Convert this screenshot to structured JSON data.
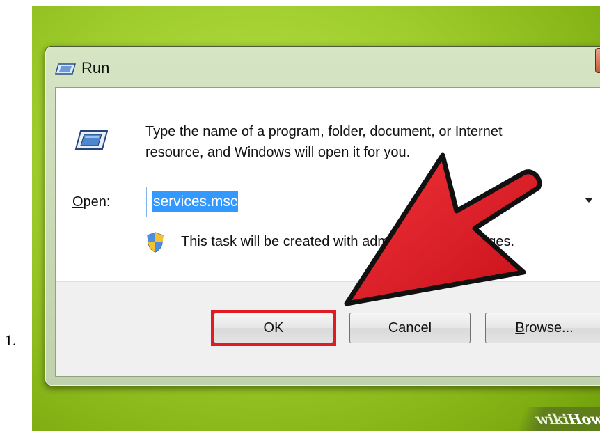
{
  "list_number": "1.",
  "dialog": {
    "title": "Run",
    "description_line1": "Type the name of a program, folder, document, or Internet",
    "description_line2": "resource, and Windows will open it for you.",
    "open_label_u": "O",
    "open_label_rest": "pen:",
    "open_value": "services.msc",
    "note": "This task will be created with administrative privileges.",
    "buttons": {
      "ok": "OK",
      "cancel": "Cancel",
      "browse_u": "B",
      "browse_rest": "rowse..."
    }
  },
  "watermark": {
    "wiki": "wiki",
    "how": "How"
  },
  "colors": {
    "background_green": "#9fcc2c",
    "highlight_red": "#e01b22",
    "arrow_red": "#d8151d",
    "selection_blue": "#3399ff"
  },
  "icons": [
    "run-icon",
    "shield-icon",
    "dropdown-arrow-icon",
    "red-arrow-icon"
  ]
}
